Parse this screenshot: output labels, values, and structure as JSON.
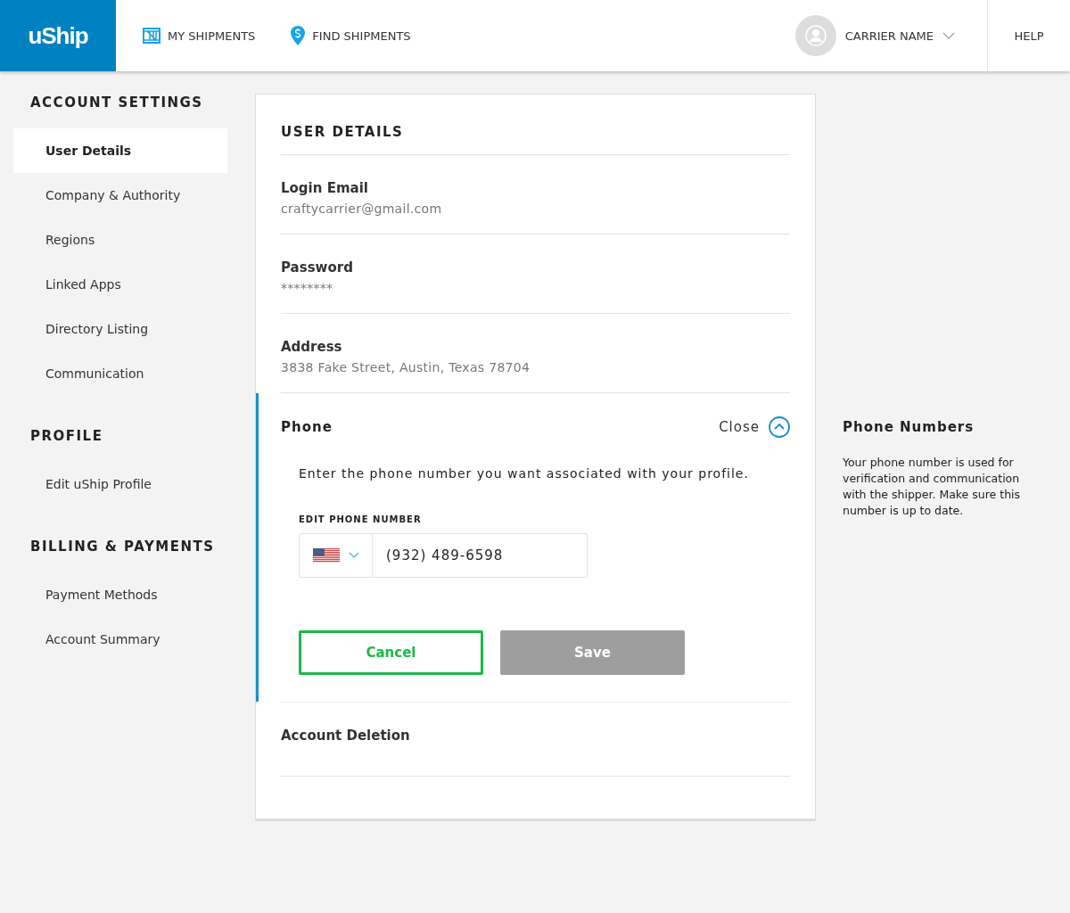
{
  "header": {
    "logo": "uShip",
    "nav": [
      {
        "label": "MY SHIPMENTS"
      },
      {
        "label": "FIND SHIPMENTS"
      }
    ],
    "user": "CARRIER NAME",
    "help": "HELP"
  },
  "sidebar": {
    "sections": [
      {
        "title": "ACCOUNT SETTINGS",
        "items": [
          {
            "label": "User Details",
            "selected": true
          },
          {
            "label": "Company & Authority",
            "selected": false
          },
          {
            "label": "Regions",
            "selected": false
          },
          {
            "label": "Linked Apps",
            "selected": false
          },
          {
            "label": "Directory Listing",
            "selected": false
          },
          {
            "label": "Communication",
            "selected": false
          }
        ]
      },
      {
        "title": "PROFILE",
        "items": [
          {
            "label": "Edit uShip Profile",
            "selected": false
          }
        ]
      },
      {
        "title": "BILLING & PAYMENTS",
        "items": [
          {
            "label": "Payment Methods",
            "selected": false
          },
          {
            "label": "Account Summary",
            "selected": false
          }
        ]
      }
    ]
  },
  "card": {
    "title": "USER DETAILS",
    "fields": [
      {
        "label": "Login Email",
        "value": "craftycarrier@gmail.com"
      },
      {
        "label": "Password",
        "value": "********"
      },
      {
        "label": "Address",
        "value": "3838 Fake Street, Austin, Texas 78704"
      }
    ],
    "phone": {
      "label": "Phone",
      "close": "Close",
      "expanded": true,
      "instruction": "Enter the phone number you want associated with your profile.",
      "field_label": "EDIT PHONE NUMBER",
      "value": "(932) 489-6598",
      "cancel": "Cancel",
      "save": {
        "label": "Save",
        "disabled": true
      }
    },
    "deletion": "Account Deletion"
  },
  "help_panel": {
    "title": "Phone Numbers",
    "text": "Your phone number is used for verification and communication with the shipper. Make sure this number is up to date."
  }
}
